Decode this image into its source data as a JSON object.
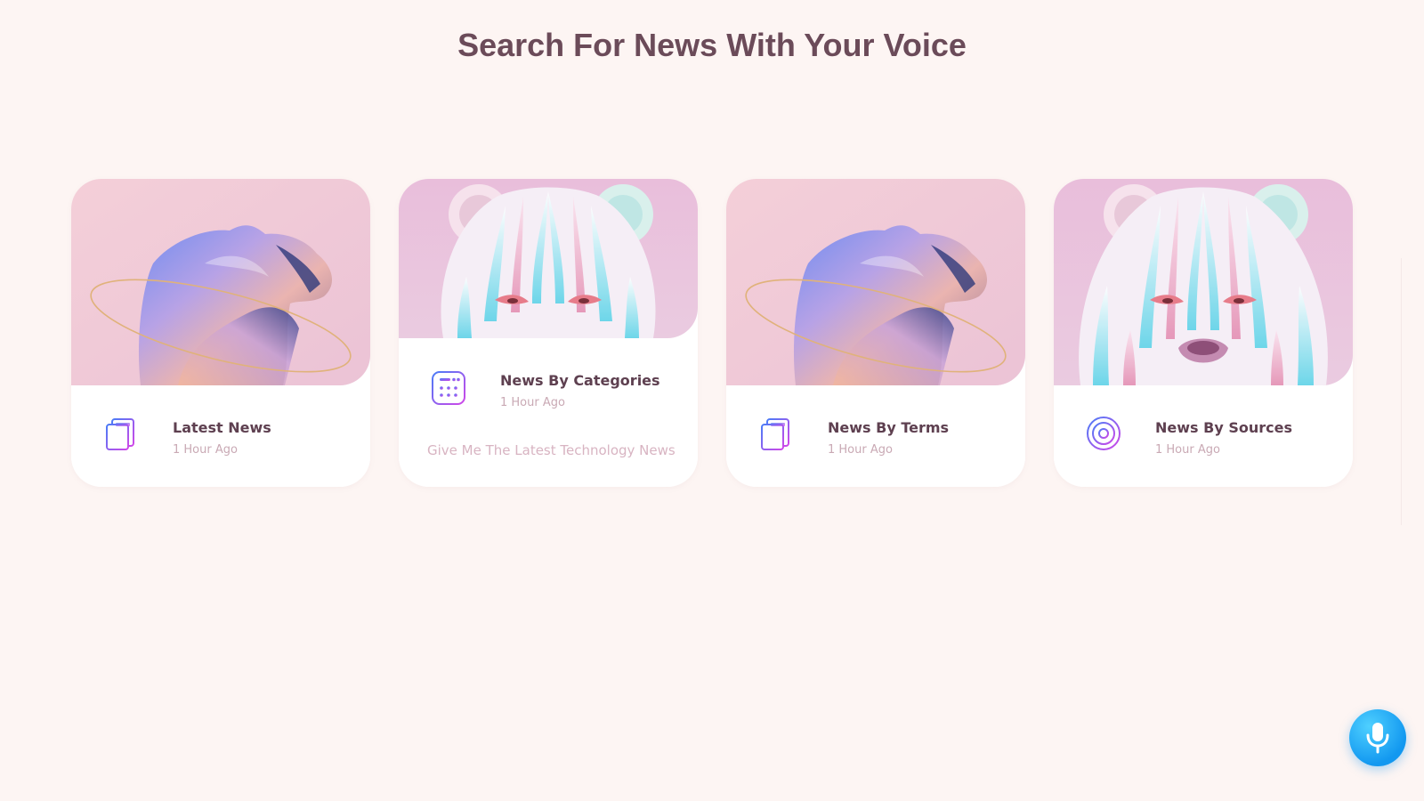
{
  "page": {
    "title": "Search For News With Your Voice"
  },
  "cards": [
    {
      "title": "Latest News",
      "time": "1 Hour Ago",
      "icon": "document-list-icon",
      "image": "iridescent-leopard-sculpture"
    },
    {
      "title": "News By Categories",
      "time": "1 Hour Ago",
      "query": "Give Me The Latest Technology News",
      "icon": "calculator-grid-icon",
      "image": "pastel-bear-face"
    },
    {
      "title": "News By Terms",
      "time": "1 Hour Ago",
      "icon": "document-list-icon",
      "image": "iridescent-leopard-sculpture"
    },
    {
      "title": "News By Sources",
      "time": "1 Hour Ago",
      "icon": "target-rings-icon",
      "image": "pastel-bear-face"
    }
  ],
  "mic": {
    "icon": "microphone-icon"
  },
  "colors": {
    "background": "#fdf5f3",
    "title": "#6b4b59",
    "card_title": "#5e4050",
    "muted": "#c9a9b4",
    "icon_gradient_start": "#4a7cf7",
    "icon_gradient_end": "#d047e8",
    "mic": "#1298f0"
  }
}
